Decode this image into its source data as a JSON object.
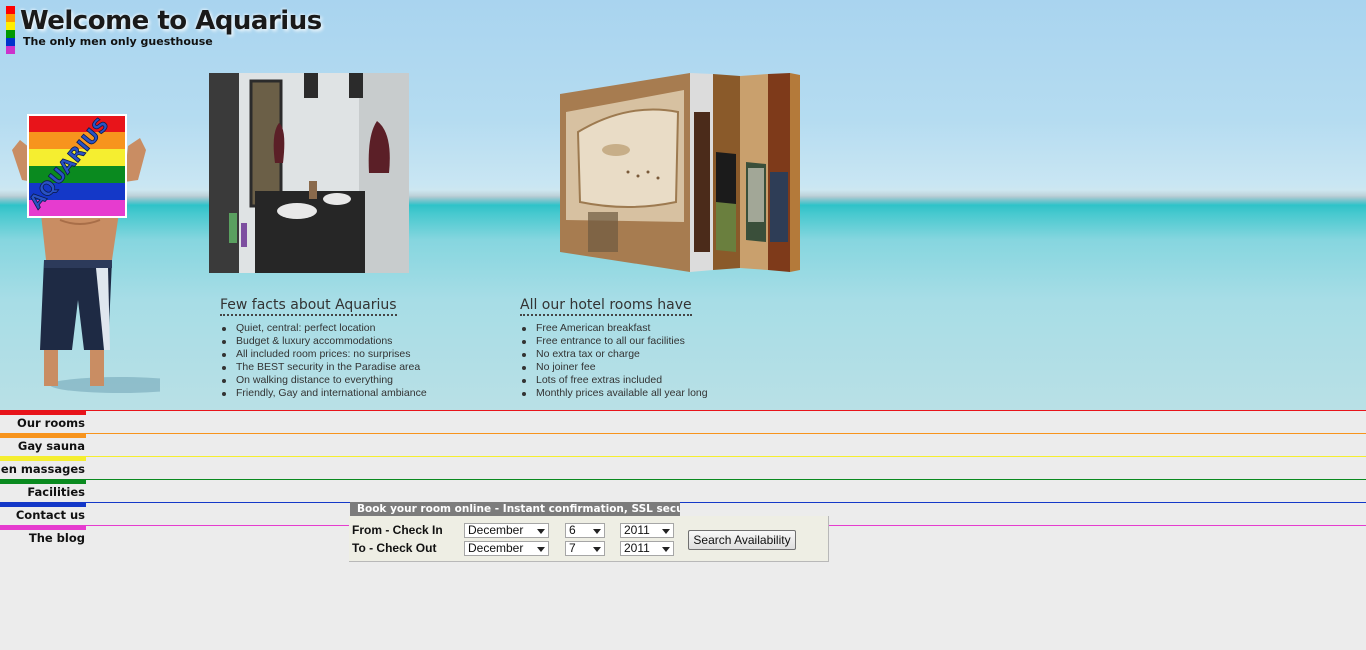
{
  "header": {
    "title": "Welcome to Aquarius",
    "subtitle": "The only men only guesthouse",
    "logo_stripe_colors": [
      "#ff0000",
      "#ff9900",
      "#ffee00",
      "#009900",
      "#0033cc",
      "#cc33cc"
    ]
  },
  "mascot": {
    "sign_text": "AQUARIUS"
  },
  "facts_section": {
    "heading": "Few facts about Aquarius",
    "items": [
      "Quiet, central: perfect location",
      "Budget & luxury accommodations",
      "All included room prices: no surprises",
      "The BEST security in the Paradise area",
      "On walking distance to everything",
      "Friendly, Gay and international ambiance"
    ]
  },
  "rooms_section": {
    "heading": "All our hotel rooms have",
    "items": [
      "Free American breakfast",
      "Free entrance to all our facilities",
      "No extra tax or charge",
      "No joiner fee",
      "Lots of free extras included",
      "Monthly prices available all year long"
    ]
  },
  "nav": {
    "items": [
      {
        "label": "Our rooms",
        "color": "#e8141a"
      },
      {
        "label": "Gay sauna",
        "color": "#f7941d"
      },
      {
        "label": "Men massages",
        "color": "#f5ee30"
      },
      {
        "label": "Facilities",
        "color": "#0a8a1f"
      },
      {
        "label": "Contact us",
        "color": "#1438c8"
      },
      {
        "label": "The blog",
        "color": "#e63ccf"
      }
    ]
  },
  "booking": {
    "title": "Book your room online - Instant confirmation, SSL secured",
    "checkin_label": "From - Check In",
    "checkout_label": "To - Check Out",
    "checkin_month": "December",
    "checkin_day": "6",
    "checkin_year": "2011",
    "checkout_month": "December",
    "checkout_day": "7",
    "checkout_year": "2011",
    "search_button": "Search Availability"
  }
}
